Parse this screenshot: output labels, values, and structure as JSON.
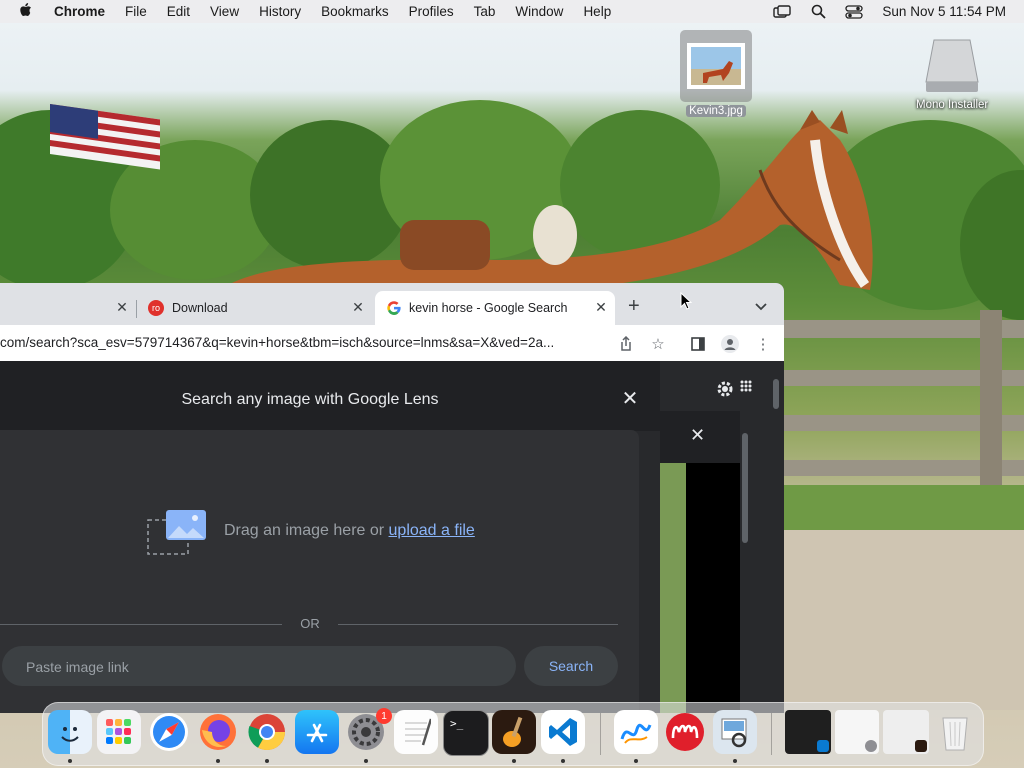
{
  "menubar": {
    "app_name": "Chrome",
    "items": [
      "File",
      "Edit",
      "View",
      "History",
      "Bookmarks",
      "Profiles",
      "Tab",
      "Window",
      "Help"
    ],
    "clock": "Sun Nov 5  11:54 PM"
  },
  "desktop": {
    "icons": [
      {
        "label": "Kevin3.jpg",
        "icon": "image-file-icon"
      },
      {
        "label": "Mono Installer",
        "icon": "disk-image-icon"
      }
    ]
  },
  "browser": {
    "tabs": [
      {
        "title": "",
        "favicon": "none"
      },
      {
        "title": "Download",
        "favicon": "red-download-icon"
      },
      {
        "title": "kevin horse - Google Search",
        "favicon": "google-icon"
      }
    ],
    "url": "com/search?sca_esv=579714367&q=kevin+horse&tbm=isch&source=lnms&sa=X&ved=2a..."
  },
  "lens": {
    "title": "Search any image with Google Lens",
    "drag_text": "Drag an image here or ",
    "upload_link": "upload a file",
    "or_text": "OR",
    "paste_placeholder": "Paste image link",
    "search_label": "Search"
  },
  "dock": {
    "apps": [
      {
        "name": "Finder",
        "icon": "finder-icon"
      },
      {
        "name": "Launchpad",
        "icon": "launchpad-icon"
      },
      {
        "name": "Safari",
        "icon": "safari-icon"
      },
      {
        "name": "Firefox",
        "icon": "firefox-icon"
      },
      {
        "name": "Google Chrome",
        "icon": "chrome-icon"
      },
      {
        "name": "App Store",
        "icon": "app-store-icon"
      },
      {
        "name": "System Settings",
        "icon": "system-settings-icon",
        "badge": "1"
      },
      {
        "name": "TextEdit",
        "icon": "textedit-icon"
      },
      {
        "name": "Terminal",
        "icon": "terminal-icon"
      },
      {
        "name": "GarageBand",
        "icon": "garageband-icon"
      },
      {
        "name": "Visual Studio Code",
        "icon": "vscode-icon"
      },
      {
        "name": "Freeform",
        "icon": "freeform-icon"
      },
      {
        "name": "Mendeley",
        "icon": "mendeley-icon"
      },
      {
        "name": "Preview",
        "icon": "preview-icon"
      }
    ]
  },
  "colors": {
    "chrome_dark_bg": "#202124",
    "lens_panel": "#303134",
    "link_blue": "#8ab4f8",
    "tabstrip": "#dfe1e5"
  }
}
